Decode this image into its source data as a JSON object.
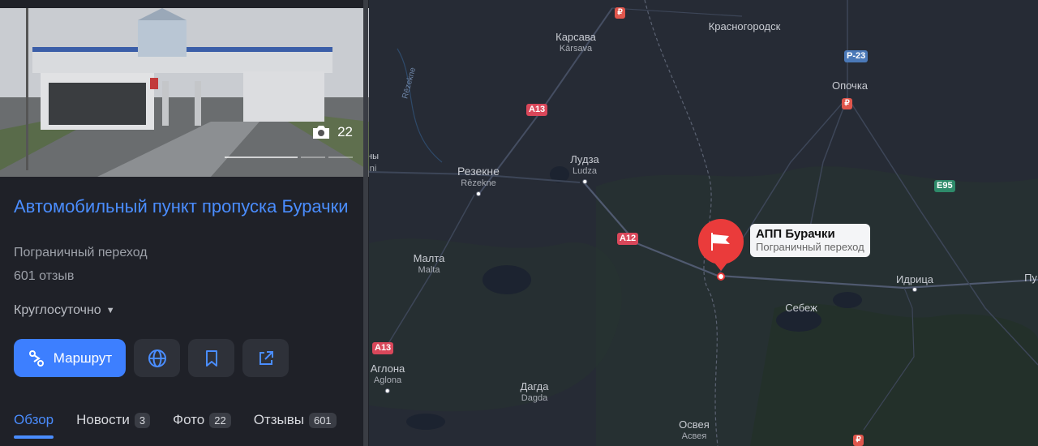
{
  "place": {
    "title": "Автомобильный пункт пропуска Бурачки",
    "category": "Пограничный переход",
    "reviews": "601 отзыв",
    "hours": "Круглосуточно",
    "photo_count": "22"
  },
  "actions": {
    "route_label": "Маршрут"
  },
  "tabs": [
    {
      "label": "Обзор",
      "badge": ""
    },
    {
      "label": "Новости",
      "badge": "3"
    },
    {
      "label": "Фото",
      "badge": "22"
    },
    {
      "label": "Отзывы",
      "badge": "601"
    }
  ],
  "map": {
    "pin_title": "АПП Бурачки",
    "pin_subtitle": "Пограничный переход",
    "cities": {
      "karsava": "Карсава",
      "karsava_lat": "Kārsava",
      "krasnogorodsk": "Красногородск",
      "opochka": "Опочка",
      "rezekne": "Резекне",
      "rezekne_lat": "Rēzekne",
      "ludza": "Лудза",
      "ludza_lat": "Ludza",
      "malta": "Малта",
      "malta_lat": "Malta",
      "aglona": "Аглона",
      "aglona_lat": "Aglona",
      "dagda": "Дагда",
      "dagda_lat": "Dagda",
      "sebezh": "Себеж",
      "idritsa": "Идрица",
      "osveya": "Освея",
      "osveya_lat": "Асвея",
      "pu": "Пу"
    },
    "roads": {
      "a13_top": "A13",
      "a12": "A12",
      "a13_bottom": "A13",
      "r23": "P-23",
      "e95": "E95"
    },
    "edge_labels": {
      "left1": "ны",
      "left2": "ni"
    },
    "river_label": "Rēzekne"
  },
  "colors": {
    "accent": "#4a8dff",
    "pin": "#ea3b3b"
  }
}
